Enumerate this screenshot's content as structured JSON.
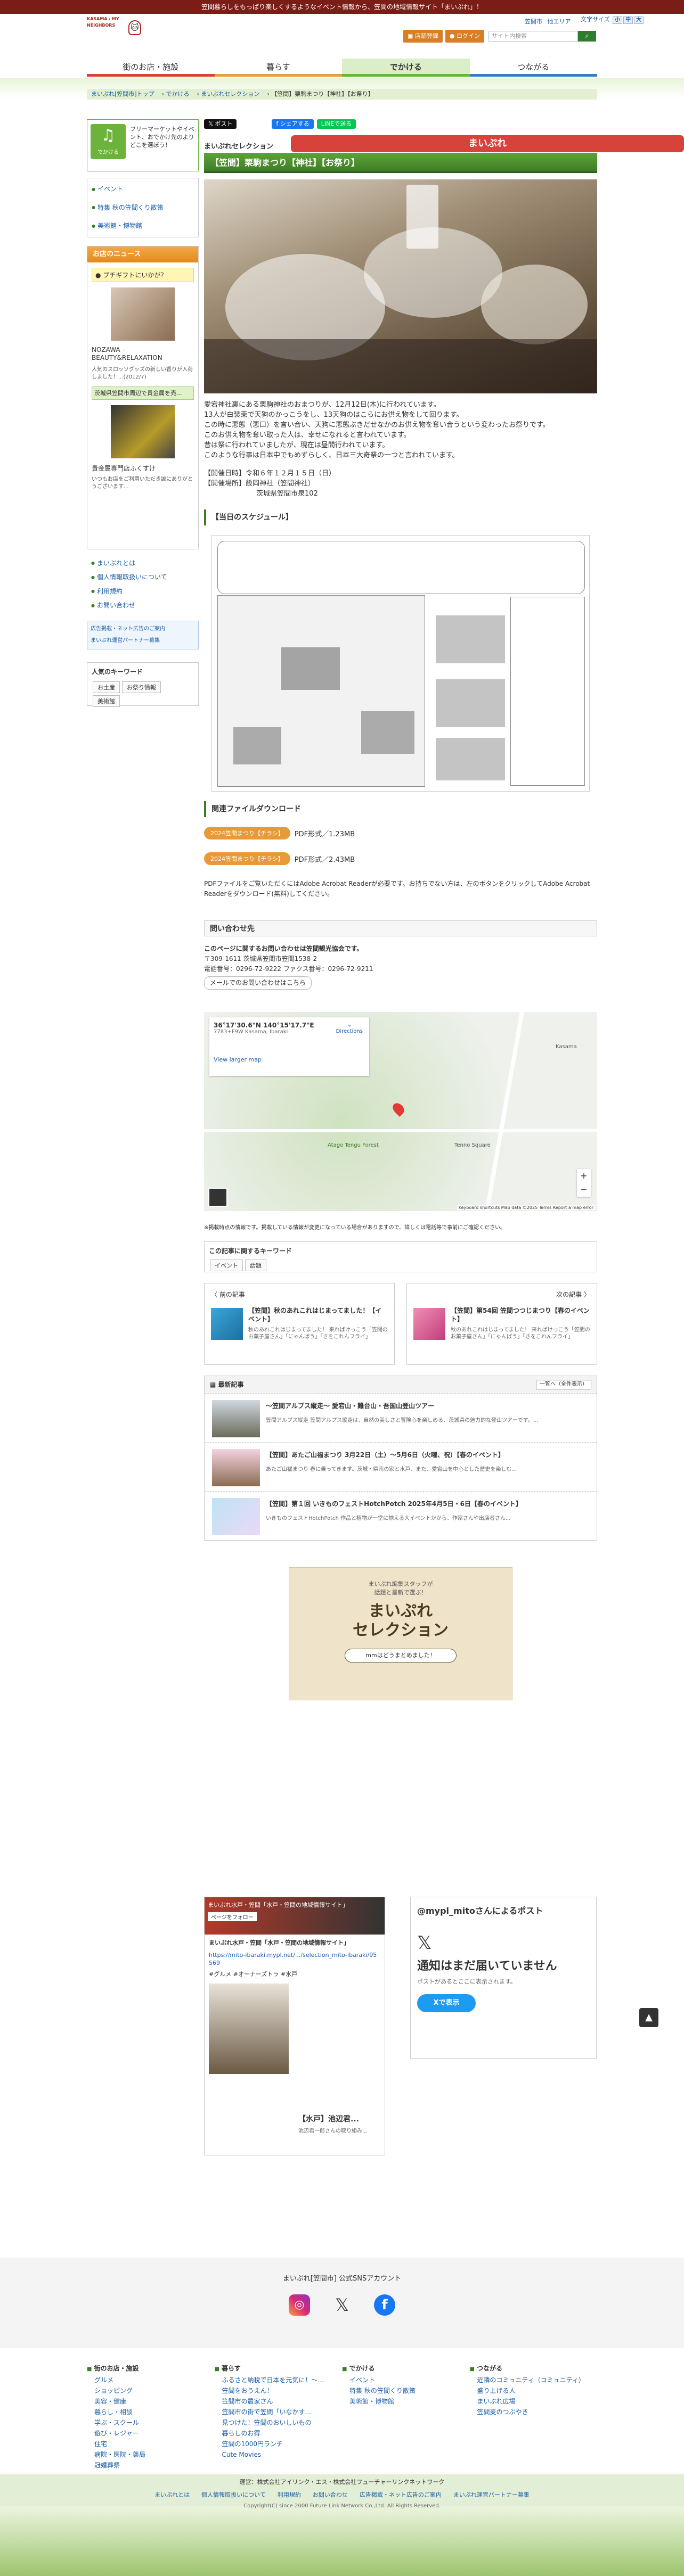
{
  "topbar": "笠間暮らしをもっぱり楽しくするようなイベント情報から、笠間の地域情報サイト「まいぷれ」！",
  "header": {
    "logo_sub": "KASAMA / MY NEIGHBORS",
    "logo_main": "まいぷれ",
    "logo_cat": "KASAMA",
    "site_region": "笠間市",
    "link_other": "他エリア",
    "font_size_label": "文字サイズ",
    "font_small": "小",
    "font_mid": "中",
    "font_large": "大",
    "reg_btn": "店舗登録",
    "login_btn": "ログイン",
    "search_placeholder": "サイト内検索",
    "search_icon": "search"
  },
  "gnav": [
    {
      "label": "街のお店・施設",
      "color": "#d7433b"
    },
    {
      "label": "暮らす",
      "color": "#e0a23a"
    },
    {
      "label": "でかける",
      "color": "#6bb33a",
      "active": true
    },
    {
      "label": "つながる",
      "color": "#3a7bc8"
    }
  ],
  "breadcrumb": [
    "まいぷれ[笠間市]トップ",
    "でかける",
    "まいぷれセレクション",
    "【笠間】栗駒まつり【神社】【お祭り】"
  ],
  "side": {
    "icon_label": "でかける",
    "intro": "フリーマーケットやイベント、おでかけ先のよりどこを選ぼう！",
    "links": [
      "イベント",
      "特集 秋の笠間くり散策",
      "美術館・博物館"
    ],
    "news_title": "お店のニュース",
    "news_tag": "プチギフトにいかが？",
    "news_text_1": "NOZAWA – BEAUTY&RELAXATION",
    "news_text_2": "人気のスロッソグッズの新しい香りが入荷しました！...(2012/7)",
    "news_text_3": "茨城県笠間市周辺で貴金属を売...",
    "news_sub": "貴金属専門店ふくすけ",
    "news_text_4": "いつもお店をご利用いただき誠にありがとうございます...",
    "info": [
      "まいぷれとは",
      "個人情報取扱いについて",
      "利用規約",
      "お問い合わせ"
    ],
    "ads": [
      "広告掲載・ネット広告のご案内",
      "まいぷれ運営パートナー募集"
    ],
    "keyword_title": "人気のキーワード",
    "keywords": [
      "お土産",
      "お祭り情報",
      "美術館"
    ]
  },
  "share": {
    "post": "ポスト",
    "fb": "シェアする",
    "line": "LINEで送る"
  },
  "collection": "まいぷれセレクション",
  "title": "【笠間】栗駒まつり【神社】【お祭り】",
  "body": [
    "愛宕神社裏にある栗駒神社のおまつりが、12月12日(木)に行われています。",
    "13人が白装束で天狗のかっこうをし、13天狗のはこらにお供え物をして回ります。",
    "この時に悪態（悪口）を言い合い、天狗に悪態ぶきだせなかのお供え物を奪い合うという変わったお祭りです。",
    "このお供え物を奪い取った人は、幸せになれると言われています。",
    "昔は祭に行われていましたが、現在は昼間行われています。",
    "このような行事は日本中でもめずらしく、日本三大奇祭の一つと言われています。"
  ],
  "date_block": [
    "【開催日時】令和６年１２月１５日（日）",
    "【開催場所】飯岡神社（笠間神社）",
    "茨城県笠間市泉102"
  ],
  "schedule_title": "【当日のスケジュール】",
  "download_title": "関連ファイルダウンロード",
  "pdfs": [
    {
      "label": "2024笠間まつり【チラシ】",
      "meta": "PDF形式／1.23MB"
    },
    {
      "label": "2024笠間まつり【チラシ】",
      "meta": "PDF形式／2.43MB"
    }
  ],
  "pdf_note": "PDFファイルをご覧いただくにはAdobe Acrobat Readerが必要です。お持ちでない方は、左のボタンをクリックしてAdobe Acrobat Readerをダウンロード(無料)してください。",
  "contact_title": "問い合わせ先",
  "contact": {
    "heading": "このページに関するお問い合わせは笠間観光協会です。",
    "addr": "〒309-1611 茨城県笠間市笠間1538-2",
    "tel": "電話番号：0296-72-9222 ファクス番号：0296-72-9211",
    "btn": "メールでのお問い合わせはこちら"
  },
  "map": {
    "coords": "36°17'30.6\"N 140°15'17.7\"E",
    "sub": "7783+F9W Kasama, Ibaraki",
    "large": "View larger map",
    "dir": "Directions",
    "place1": "Atago Tengu Forest",
    "place2": "Tenno Square",
    "place3": "Kasama",
    "footer": "Keyboard shortcuts  Map data ©2025  Terms  Report a map error"
  },
  "map_note": "※掲載時点の情報です。掲載している情報が変更になっている場合がありますので、詳しくは電話等で事前にご確認ください。",
  "kw_box": {
    "title": "この記事に関するキーワード",
    "tags": [
      "イベント",
      "話題"
    ]
  },
  "prev": {
    "nav": "〈 前の記事",
    "title": "【笠間】秋のあれこれはじまってました！【イベント】",
    "text": "秋のあれこれはじまってました！ 来ればけっこう「笠間のお菓子屋さん」「にゃんぱう」「さをこれんフライ」"
  },
  "next": {
    "nav": "次の記事 〉",
    "title": "【笠間】第54回 笠間つつじまつり【春のイベント】",
    "text": "秋のあれこれはじまってました！ 来ればけっこう「笠間のお菓子屋さん」「にゃんぱう」「さをこれんフライ」"
  },
  "latest": {
    "title": "最新記事",
    "btn": "一覧へ（全件表示）",
    "items": [
      {
        "title": "～笠間アルプス縦走～ 愛宕山・難台山・吾国山登山ツアー",
        "text": "笠間アルプス縦走 笠間アルプス縦走は、自然の美しさと冒険心を楽しめる、茨城県の魅力的な登山ツアーです。..."
      },
      {
        "title": "【笠間】あたご山福まつり 3月22日（土）～5月6日（火曜、祝）【春のイベント】",
        "text": "あたご山福まつり 春に乗ってきます。茨城・県南の家と水戸、また、愛宕山を中心とした歴史を楽しむ..."
      },
      {
        "title": "【笠間】第１回 いきものフェストHotchPotch 2025年4月5日・6日【春のイベント】",
        "text": "いきものフェストHotchPotch 作品と植物が一堂に揃える大イベントかから、作家さんや出店者さん..."
      }
    ]
  },
  "banner": {
    "top": "まいぷれ編集スタッフが\n話題と最新で選ぶ！",
    "main": "まいぷれ\nセレクション",
    "bottom": "mmはどうまとめました！"
  },
  "fb": {
    "page": "まいぷれ水戸・笠間「水戸・笠間の地域情報サイト」",
    "follow": "ページをフォロー",
    "post_title": "まいぷれ水戸・笠間「水戸・笠間の地域情報サイト」",
    "link": "https://mito-ibaraki.mypl.net/.../selection_mito-ibaraki/95569",
    "tags": "#グルメ #オーナーズトラ #水戸",
    "card_title": "【水戸】池辺君...",
    "card_sub": "池辺君一郎さんの取り組み..."
  },
  "x": {
    "title": "@mypl_mitoさんによるポスト",
    "msg_title": "通知はまだ届いていません",
    "msg": "ポストがあるとここに表示されます。",
    "btn": "Xで表示"
  },
  "sns_title": "まいぷれ[笠間市] 公式SNSアカウント",
  "fnav": [
    {
      "title": "街のお店・施設",
      "links": [
        "グルメ",
        "ショッピング",
        "美容・健康",
        "暮らし・相談",
        "学ぶ・スクール",
        "遊び・レジャー",
        "住宅",
        "病院・医院・薬局",
        "冠婚葬祭",
        "求人"
      ]
    },
    {
      "title": "暮らす",
      "links": [
        "ふるさと納税で日本を元気に！～...",
        "笠間をおうえん！",
        "笠間市の農家さん",
        "笠間市の街で笠間「いなかす...",
        "見つけた！笠間のおいしいもの",
        "暮らしのお得",
        "笠間の1000円ランチ",
        "Cute Movies"
      ]
    },
    {
      "title": "でかける",
      "links": [
        "イベント",
        "特集 秋の笠間くり散策",
        "美術館・博物館"
      ]
    },
    {
      "title": "つながる",
      "links": [
        "近隣のコミュニティ（コミュニティ）",
        "盛り上げる人",
        "まいぷれ広場",
        "笠間麦のつぶやき"
      ]
    }
  ],
  "footer": {
    "operator": "運営：株式会社アイリンク・エス・株式会社フューチャーリンクネットワーク",
    "links": [
      "まいぷれとは",
      "個人情報取扱いについて",
      "利用規約",
      "お問い合わせ",
      "広告掲載・ネット広告のご案内",
      "まいぷれ運営パートナー募集"
    ],
    "copyright": "Copyright(C) since 2000 Future Link Network Co.,Ltd. All Rights Reserved."
  },
  "colors": {
    "green": "#3c7d26",
    "orange": "#e38a1b",
    "red": "#d7433b",
    "maroon": "#7a1d16"
  }
}
